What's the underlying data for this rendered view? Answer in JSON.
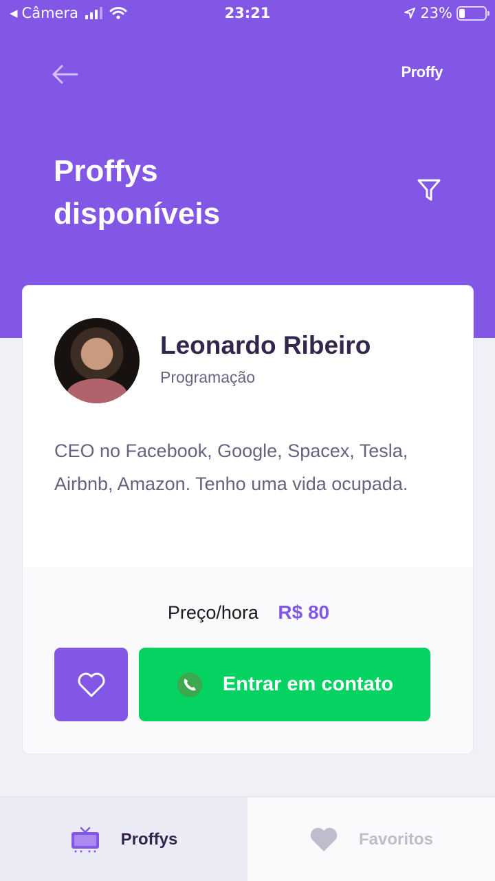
{
  "status_bar": {
    "back_app": "Câmera",
    "time": "23:21",
    "battery": "23%"
  },
  "header": {
    "brand": "Proffy",
    "title_line1": "Proffys",
    "title_line2": "disponíveis"
  },
  "teacher": {
    "name": "Leonardo Ribeiro",
    "subject": "Programação",
    "bio": "CEO no Facebook, Google, Spacex, Tesla, Airbnb, Amazon. Tenho uma vida ocupada.",
    "price_label": "Preço/hora",
    "price_value": "R$ 80",
    "contact_label": "Entrar em contato"
  },
  "tabs": [
    {
      "label": "Proffys",
      "icon": "tv-icon",
      "active": true
    },
    {
      "label": "Favoritos",
      "icon": "heart-icon",
      "active": false
    }
  ],
  "colors": {
    "primary": "#8257e5",
    "secondary": "#04d361",
    "title": "#32264d",
    "text": "#6a6180",
    "background": "#f0f0f7"
  }
}
